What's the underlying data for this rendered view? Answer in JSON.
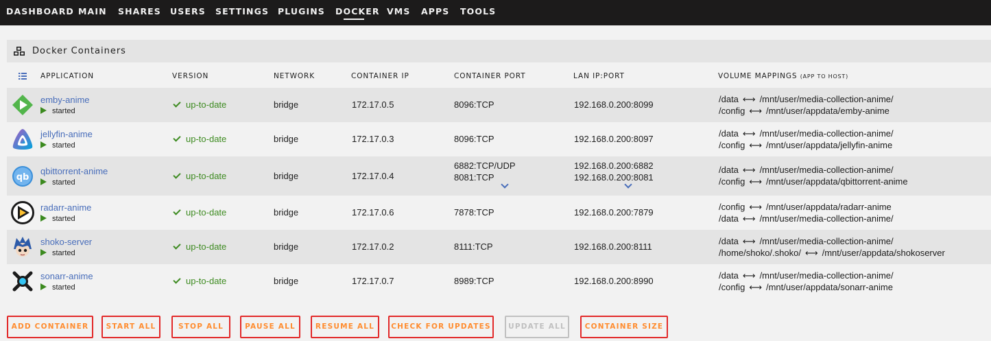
{
  "nav": {
    "items": [
      "DASHBOARD",
      "MAIN",
      "SHARES",
      "USERS",
      "SETTINGS",
      "PLUGINS",
      "DOCKER",
      "VMS",
      "APPS",
      "TOOLS"
    ],
    "active": "DOCKER"
  },
  "panel": {
    "title": "Docker Containers",
    "icon": "cubes-icon"
  },
  "columns": {
    "application": "APPLICATION",
    "version": "VERSION",
    "network": "NETWORK",
    "container_ip": "CONTAINER IP",
    "container_port": "CONTAINER PORT",
    "lan_ip_port": "LAN IP:PORT",
    "volume_mappings": "VOLUME MAPPINGS",
    "volume_mappings_sub": "(APP TO HOST)"
  },
  "arrow_glyph": "⟷",
  "containers": [
    {
      "name": "emby-anime",
      "state": "started",
      "version": "up-to-date",
      "network": "bridge",
      "container_ip": "172.17.0.5",
      "ports": [
        "8096:TCP"
      ],
      "lan": [
        "192.168.0.200:8099"
      ],
      "volumes": [
        [
          "/data",
          "/mnt/user/media-collection-anime/"
        ],
        [
          "/config",
          "/mnt/user/appdata/emby-anime"
        ]
      ],
      "icon": "emby-icon",
      "expandable": false
    },
    {
      "name": "jellyfin-anime",
      "state": "started",
      "version": "up-to-date",
      "network": "bridge",
      "container_ip": "172.17.0.3",
      "ports": [
        "8096:TCP"
      ],
      "lan": [
        "192.168.0.200:8097"
      ],
      "volumes": [
        [
          "/data",
          "/mnt/user/media-collection-anime/"
        ],
        [
          "/config",
          "/mnt/user/appdata/jellyfin-anime"
        ]
      ],
      "icon": "jellyfin-icon",
      "expandable": false
    },
    {
      "name": "qbittorrent-anime",
      "state": "started",
      "version": "up-to-date",
      "network": "bridge",
      "container_ip": "172.17.0.4",
      "ports": [
        "6882:TCP/UDP",
        "8081:TCP"
      ],
      "lan": [
        "192.168.0.200:6882",
        "192.168.0.200:8081"
      ],
      "volumes": [
        [
          "/data",
          "/mnt/user/media-collection-anime/"
        ],
        [
          "/config",
          "/mnt/user/appdata/qbittorrent-anime"
        ]
      ],
      "icon": "qbittorrent-icon",
      "expandable": true
    },
    {
      "name": "radarr-anime",
      "state": "started",
      "version": "up-to-date",
      "network": "bridge",
      "container_ip": "172.17.0.6",
      "ports": [
        "7878:TCP"
      ],
      "lan": [
        "192.168.0.200:7879"
      ],
      "volumes": [
        [
          "/config",
          "/mnt/user/appdata/radarr-anime"
        ],
        [
          "/data",
          "/mnt/user/media-collection-anime/"
        ]
      ],
      "icon": "radarr-icon",
      "expandable": false
    },
    {
      "name": "shoko-server",
      "state": "started",
      "version": "up-to-date",
      "network": "bridge",
      "container_ip": "172.17.0.2",
      "ports": [
        "8111:TCP"
      ],
      "lan": [
        "192.168.0.200:8111"
      ],
      "volumes": [
        [
          "/data",
          "/mnt/user/media-collection-anime/"
        ],
        [
          "/home/shoko/.shoko/",
          "/mnt/user/appdata/shokoserver"
        ]
      ],
      "icon": "shoko-icon",
      "expandable": false
    },
    {
      "name": "sonarr-anime",
      "state": "started",
      "version": "up-to-date",
      "network": "bridge",
      "container_ip": "172.17.0.7",
      "ports": [
        "8989:TCP"
      ],
      "lan": [
        "192.168.0.200:8990"
      ],
      "volumes": [
        [
          "/data",
          "/mnt/user/media-collection-anime/"
        ],
        [
          "/config",
          "/mnt/user/appdata/sonarr-anime"
        ]
      ],
      "icon": "sonarr-icon",
      "expandable": false
    }
  ],
  "buttons": [
    {
      "label": "ADD CONTAINER",
      "enabled": true
    },
    {
      "label": "START ALL",
      "enabled": true
    },
    {
      "label": "STOP ALL",
      "enabled": true
    },
    {
      "label": "PAUSE ALL",
      "enabled": true
    },
    {
      "label": "RESUME ALL",
      "enabled": true
    },
    {
      "label": "CHECK FOR UPDATES",
      "enabled": true
    },
    {
      "label": "UPDATE ALL",
      "enabled": false
    },
    {
      "label": "CONTAINER SIZE",
      "enabled": true
    }
  ],
  "colors": {
    "accent": "#ff8c2f",
    "button_border": "#e22828",
    "link": "#486dba",
    "ok": "#3c8a1f",
    "nav_bg": "#1c1b1b"
  }
}
